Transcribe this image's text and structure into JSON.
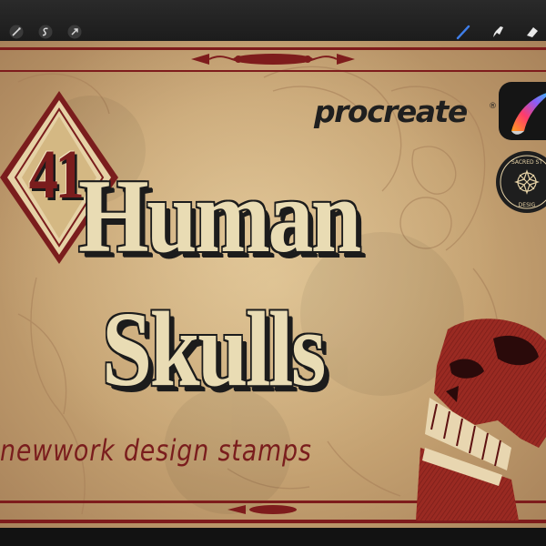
{
  "toolbar": {
    "left_tools": [
      "wand-icon",
      "selection-icon",
      "transform-icon"
    ],
    "right_tools": [
      "brush-icon",
      "smudge-icon",
      "eraser-icon"
    ],
    "active_tool": "brush-icon",
    "active_color": "#3f7ee8"
  },
  "artwork": {
    "count": "41",
    "title_line_1": "Human",
    "title_line_2": "Skulls",
    "subtitle": "newwork design stamps",
    "brand": "procreate",
    "brand_mark": "®",
    "seal_text": "SACRED ST DESIG",
    "colors": {
      "accent_red": "#7a1d1d",
      "parchment": "#c9a878",
      "ink": "#1c1c1c",
      "cream": "#e9dcb4"
    }
  }
}
